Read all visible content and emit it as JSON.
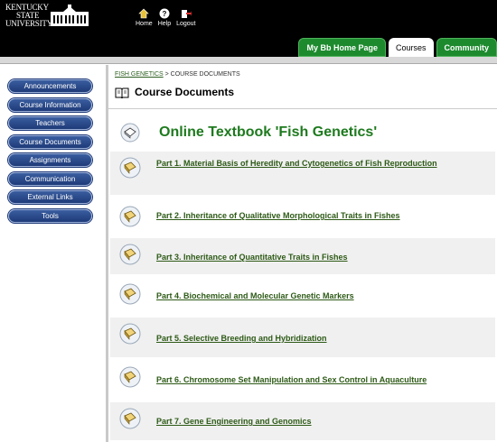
{
  "header": {
    "logo_lines": [
      "KENTUCKY",
      "STATE",
      "UNIVERSITY"
    ],
    "nav": [
      {
        "label": "Home",
        "icon": "home-icon"
      },
      {
        "label": "Help",
        "icon": "help-icon"
      },
      {
        "label": "Logout",
        "icon": "logout-icon"
      }
    ],
    "tabs": [
      {
        "label": "My Bb Home Page",
        "active": false
      },
      {
        "label": "Courses",
        "active": true
      },
      {
        "label": "Community",
        "active": false
      }
    ]
  },
  "sidebar": {
    "items": [
      {
        "label": "Announcements"
      },
      {
        "label": "Course Information"
      },
      {
        "label": "Teachers"
      },
      {
        "label": "Course Documents"
      },
      {
        "label": "Assignments"
      },
      {
        "label": "Communication"
      },
      {
        "label": "External Links"
      },
      {
        "label": "Tools"
      }
    ]
  },
  "main": {
    "breadcrumb_link": "FISH GENETICS",
    "breadcrumb_current": " > COURSE DOCUMENTS",
    "page_title": "Course Documents",
    "heading": "Online Textbook 'Fish Genetics'",
    "parts": [
      {
        "label": "Part 1. Material Basis of Heredity and Cytogenetics of Fish Reproduction"
      },
      {
        "label": "Part 2. Inheritance of Qualitative Morphological Traits in Fishes"
      },
      {
        "label": "Part 3. Inheritance of Quantitative Traits in Fishes"
      },
      {
        "label": "Part 4. Biochemical and Molecular Genetic Markers"
      },
      {
        "label": "Part 5. Selective Breeding and Hybridization"
      },
      {
        "label": "Part 6. Chromosome Set Manipulation and Sex Control in Aquaculture"
      },
      {
        "label": "Part 7. Gene Engineering and Genomics"
      }
    ]
  },
  "colors": {
    "tab_green": "#1d8a2e",
    "sidebar_button": "#2a4b8c",
    "heading_green": "#1e7a1e",
    "link_green": "#2d5a16"
  }
}
